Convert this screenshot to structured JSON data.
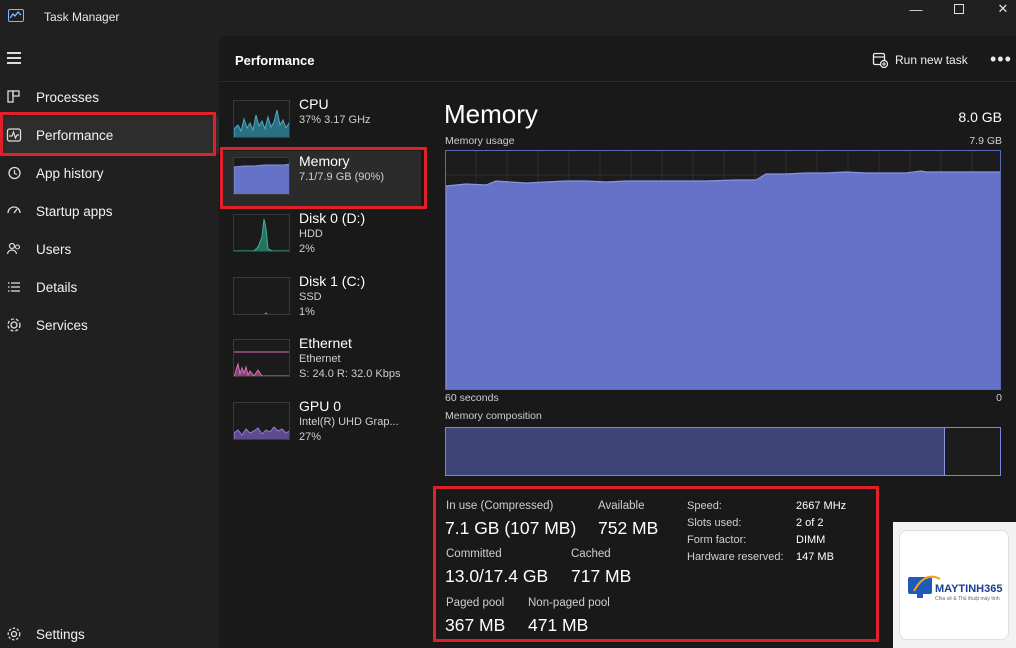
{
  "window": {
    "title": "Task Manager"
  },
  "nav": {
    "items": [
      {
        "label": "Processes",
        "icon": "processes-icon"
      },
      {
        "label": "Performance",
        "icon": "performance-icon",
        "active": true
      },
      {
        "label": "App history",
        "icon": "history-icon"
      },
      {
        "label": "Startup apps",
        "icon": "startup-icon"
      },
      {
        "label": "Users",
        "icon": "users-icon"
      },
      {
        "label": "Details",
        "icon": "details-icon"
      },
      {
        "label": "Services",
        "icon": "services-icon"
      }
    ],
    "settings_label": "Settings"
  },
  "header": {
    "title": "Performance",
    "run_task_label": "Run new task",
    "more_label": "•••"
  },
  "devices": [
    {
      "name": "CPU",
      "sub1": "37% 3.17 GHz",
      "sub2": ""
    },
    {
      "name": "Memory",
      "sub1": "7.1/7.9 GB (90%)",
      "sub2": ""
    },
    {
      "name": "Disk 0 (D:)",
      "sub1": "HDD",
      "sub2": "2%"
    },
    {
      "name": "Disk 1 (C:)",
      "sub1": "SSD",
      "sub2": "1%"
    },
    {
      "name": "Ethernet",
      "sub1": "Ethernet",
      "sub2": "S: 24.0  R: 32.0 Kbps"
    },
    {
      "name": "GPU 0",
      "sub1": "Intel(R) UHD Grap...",
      "sub2": "27%"
    }
  ],
  "memory": {
    "title": "Memory",
    "total": "8.0 GB",
    "usage_label": "Memory usage",
    "usage_max": "7.9 GB",
    "time_label": "60 seconds",
    "time_end": "0",
    "composition_label": "Memory composition",
    "composition_used_fraction": 0.9,
    "usage_fraction": 0.9,
    "stats": {
      "in_use_label": "In use (Compressed)",
      "in_use_value": "7.1 GB (107 MB)",
      "available_label": "Available",
      "available_value": "752 MB",
      "committed_label": "Committed",
      "committed_value": "13.0/17.4 GB",
      "cached_label": "Cached",
      "cached_value": "717 MB",
      "paged_label": "Paged pool",
      "paged_value": "367 MB",
      "nonpaged_label": "Non-paged pool",
      "nonpaged_value": "471 MB"
    },
    "specs": [
      {
        "label": "Speed:",
        "value": "2667 MHz"
      },
      {
        "label": "Slots used:",
        "value": "2 of 2"
      },
      {
        "label": "Form factor:",
        "value": "DIMM"
      },
      {
        "label": "Hardware reserved:",
        "value": "147 MB"
      }
    ]
  },
  "watermark": {
    "brand": "MAYTINH365",
    "tagline": "Chia sẻ & Thủ thuật máy tính"
  },
  "colors": {
    "accent_highlight": "#e0202a",
    "memory_fill": "#6672c8",
    "cpu": "#4fa9c4",
    "disk": "#3fb39a",
    "ethernet": "#d872b5",
    "gpu": "#9a7ad4"
  }
}
